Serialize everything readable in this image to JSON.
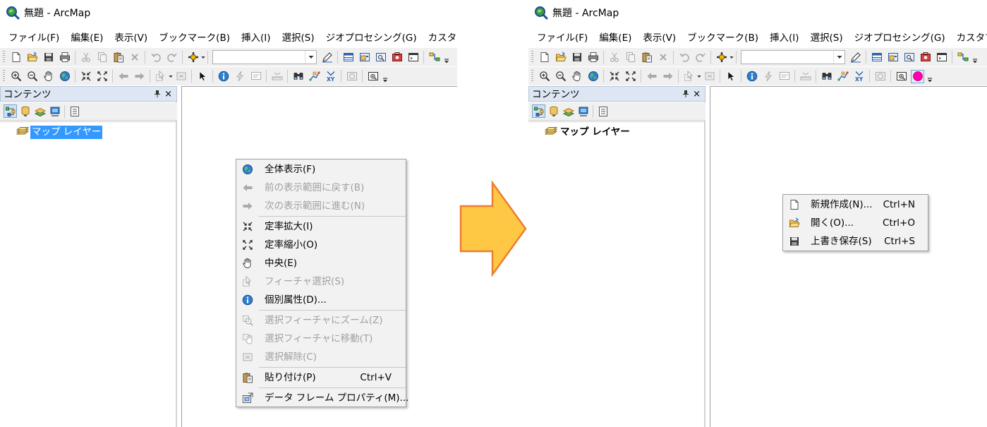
{
  "colors": {
    "arrow_fill": "#ffc844",
    "arrow_stroke": "#ed7d31",
    "selection_bg": "#3399ff",
    "contents_header_bg": "#dde6f2",
    "menu_bg": "#f2f2f2",
    "disabled_text": "#a0a0a0",
    "pink_button": "#ff00aa"
  },
  "left": {
    "window_title": "無題 - ArcMap",
    "menus": [
      "ファイル(F)",
      "編集(E)",
      "表示(V)",
      "ブックマーク(B)",
      "挿入(I)",
      "選択(S)",
      "ジオプロセシング(G)",
      "カスタマイズ(C)"
    ],
    "contents": {
      "title": "コンテンツ",
      "close": "×",
      "layer_label": "マップ レイヤー"
    },
    "context_menu": {
      "items": [
        {
          "label": "全体表示(F)",
          "icon": "globe-icon",
          "enabled": true
        },
        {
          "label": "前の表示範囲に戻す(B)",
          "icon": "back-arrow-icon",
          "enabled": false
        },
        {
          "label": "次の表示範囲に進む(N)",
          "icon": "forward-arrow-icon",
          "enabled": false
        },
        {
          "label": "定率拡大(I)",
          "icon": "fixed-zoom-in-icon",
          "enabled": true
        },
        {
          "label": "定率縮小(O)",
          "icon": "fixed-zoom-out-icon",
          "enabled": true
        },
        {
          "label": "中央(E)",
          "icon": "pan-hand-icon",
          "enabled": true
        },
        {
          "label": "フィーチャ選択(S)",
          "icon": "select-features-icon",
          "enabled": false
        },
        {
          "label": "個別属性(D)...",
          "icon": "identify-icon",
          "enabled": true
        },
        {
          "label": "選択フィーチャにズーム(Z)",
          "icon": "zoom-to-selected-icon",
          "enabled": false
        },
        {
          "label": "選択フィーチャに移動(T)",
          "icon": "pan-to-selected-icon",
          "enabled": false
        },
        {
          "label": "選択解除(C)",
          "icon": "clear-selection-icon",
          "enabled": false
        },
        {
          "label": "貼り付け(P)",
          "icon": "paste-icon",
          "enabled": true,
          "shortcut": "Ctrl+V"
        },
        {
          "label": "データ フレーム プロパティ(M)...",
          "icon": "data-frame-properties-icon",
          "enabled": true
        }
      ]
    }
  },
  "right": {
    "window_title": "無題 - ArcMap",
    "menus": [
      "ファイル(F)",
      "編集(E)",
      "表示(V)",
      "ブックマーク(B)",
      "挿入(I)",
      "選択(S)",
      "ジオプロセシング(G)",
      "カスタマイズ(C)"
    ],
    "contents": {
      "title": "コンテンツ",
      "close": "×",
      "layer_label": "マップ レイヤー"
    },
    "context_menu": {
      "items": [
        {
          "label": "新規作成(N)...",
          "icon": "new-document-icon",
          "shortcut": "Ctrl+N"
        },
        {
          "label": "開く(O)...",
          "icon": "open-folder-icon",
          "shortcut": "Ctrl+O"
        },
        {
          "label": "上書き保存(S)",
          "icon": "save-icon",
          "shortcut": "Ctrl+S"
        }
      ]
    }
  }
}
